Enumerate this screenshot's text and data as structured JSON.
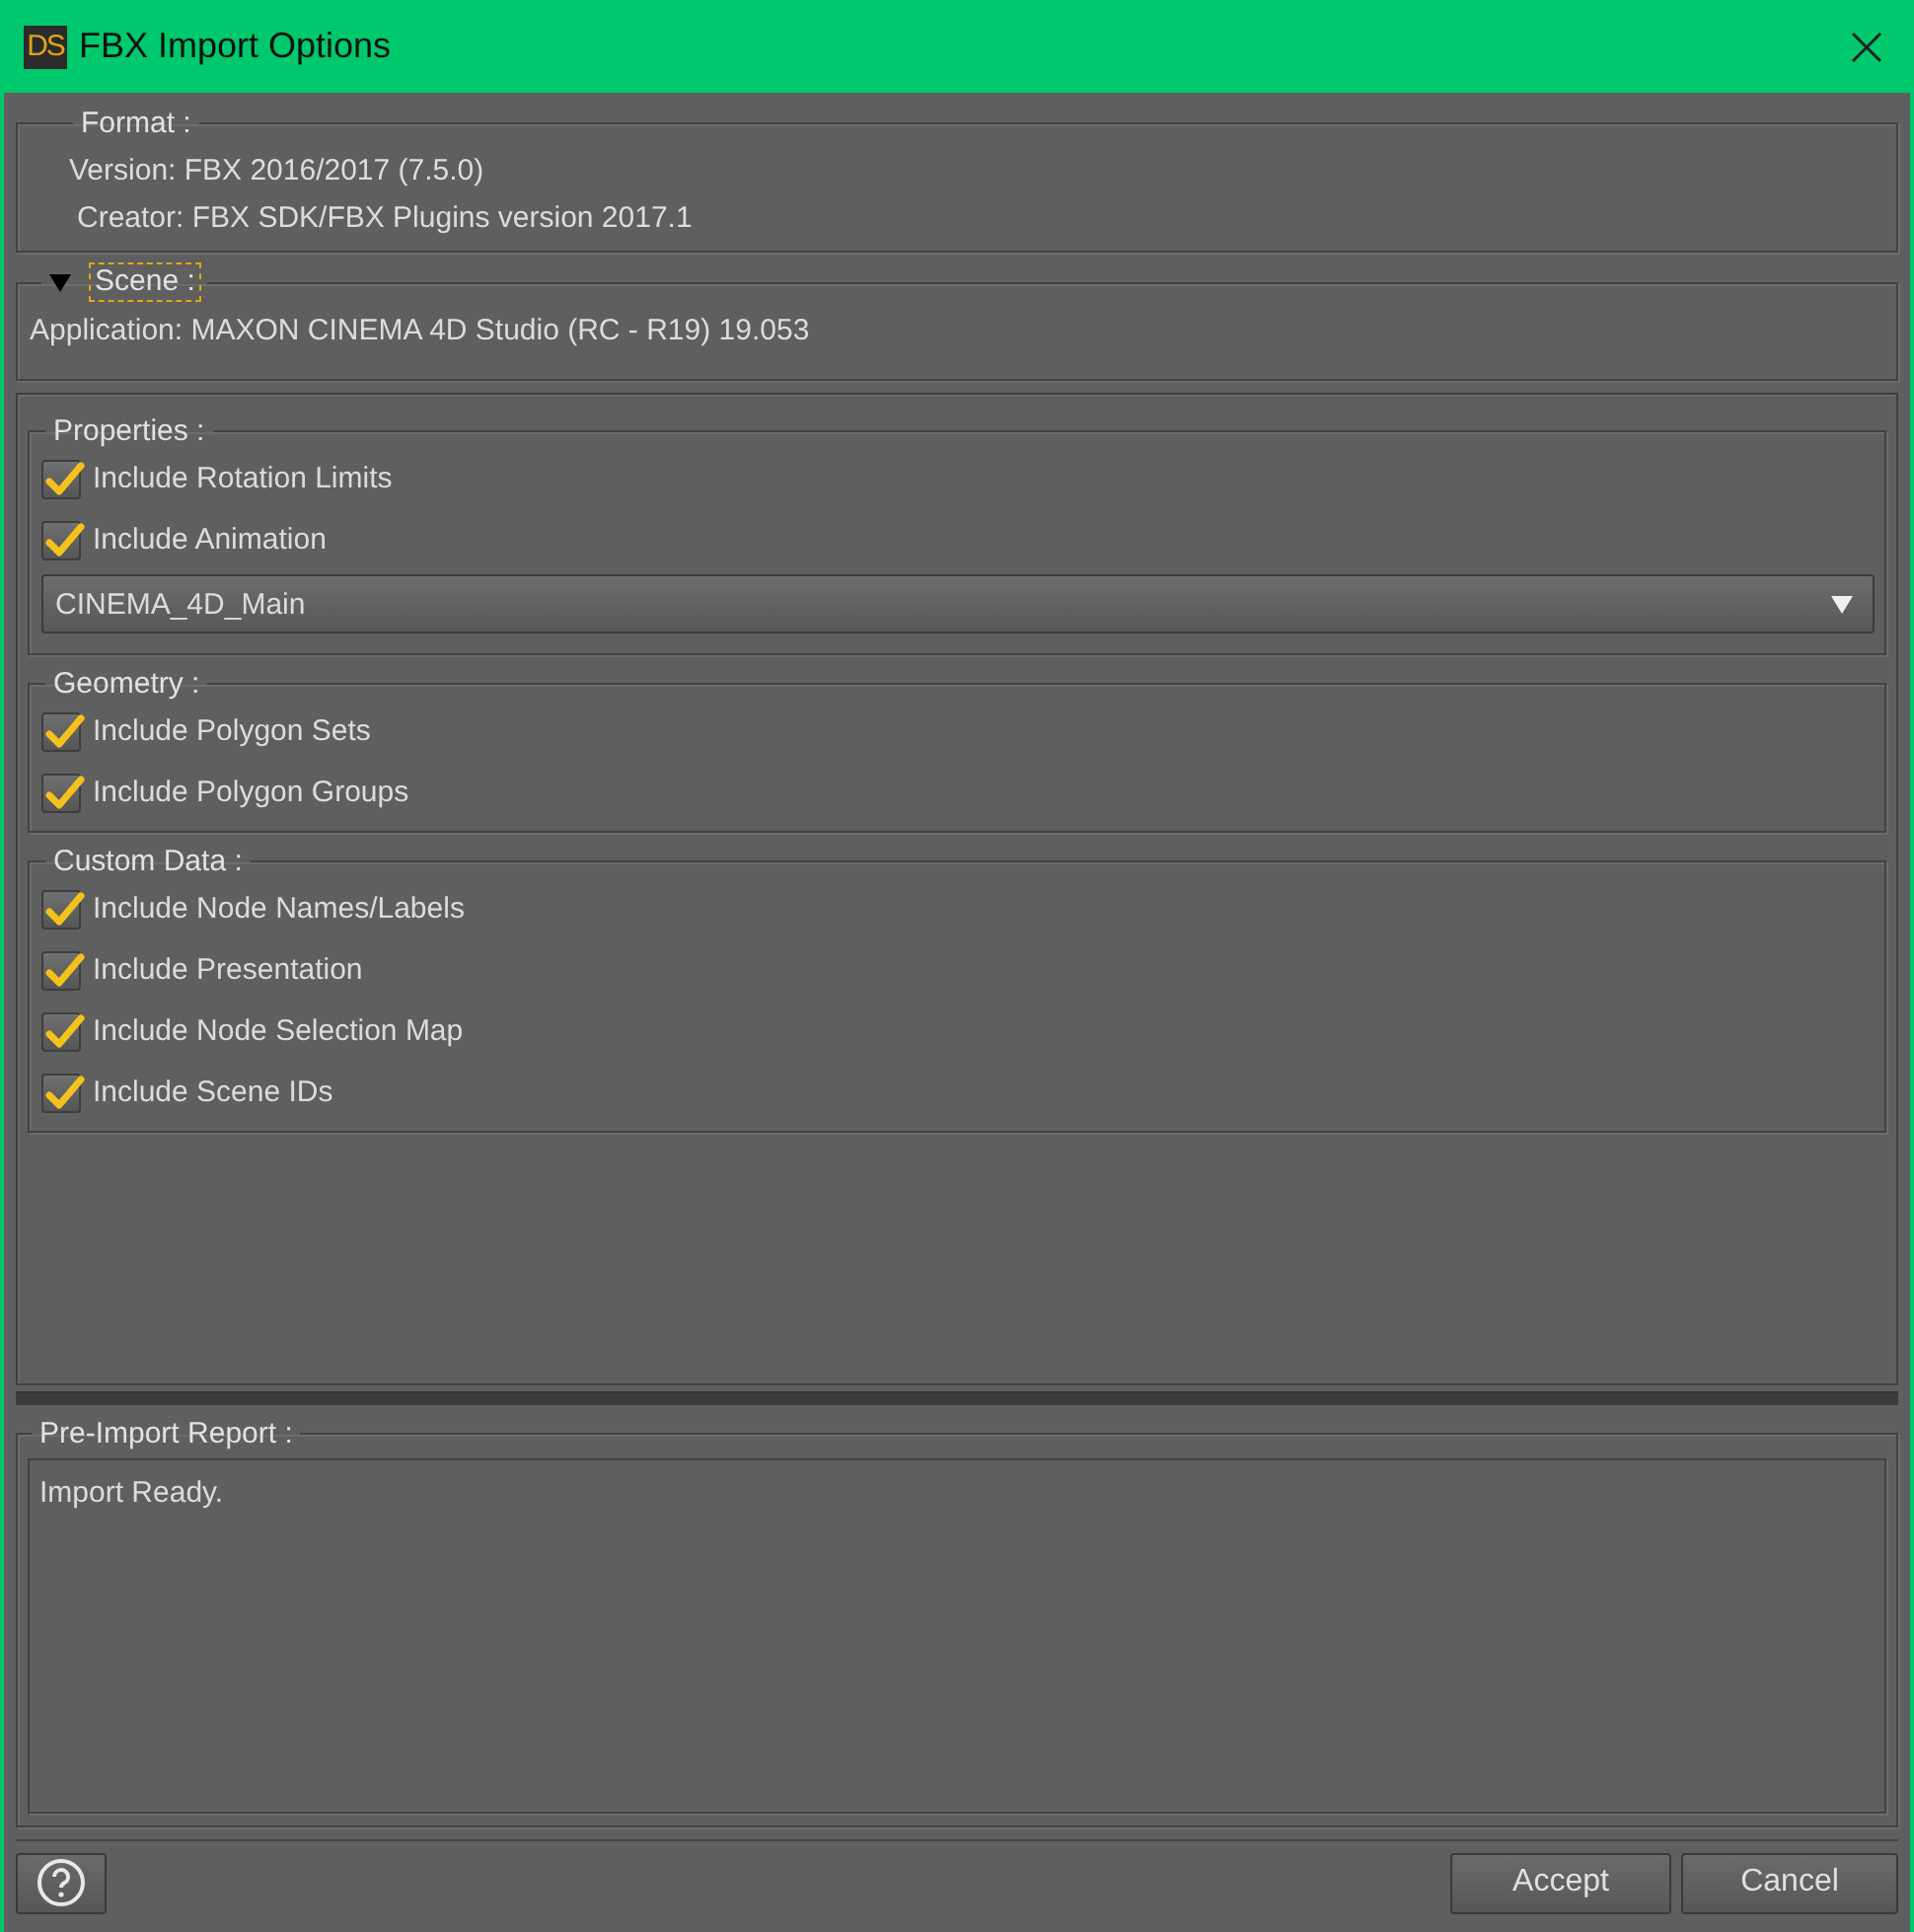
{
  "window": {
    "title": "FBX Import Options",
    "app_badge": "DS"
  },
  "format": {
    "label": "Format :",
    "lines": [
      "Version: FBX 2016/2017 (7.5.0)",
      "Creator: FBX SDK/FBX Plugins version 2017.1"
    ]
  },
  "scene": {
    "label": "Scene :",
    "expanded": true,
    "focused": true,
    "lines": [
      "Application: MAXON CINEMA 4D Studio (RC - R19) 19.053"
    ]
  },
  "sections": [
    {
      "label": "Properties :",
      "items": [
        {
          "kind": "checkbox",
          "label": "Include Rotation Limits",
          "checked": true
        },
        {
          "kind": "checkbox",
          "label": "Include Animation",
          "checked": true
        },
        {
          "kind": "dropdown",
          "value": "CINEMA_4D_Main"
        }
      ]
    },
    {
      "label": "Geometry :",
      "items": [
        {
          "kind": "checkbox",
          "label": "Include Polygon Sets",
          "checked": true
        },
        {
          "kind": "checkbox",
          "label": "Include Polygon Groups",
          "checked": true
        }
      ]
    },
    {
      "label": "Custom Data :",
      "items": [
        {
          "kind": "checkbox",
          "label": "Include Node Names/Labels",
          "checked": true
        },
        {
          "kind": "checkbox",
          "label": "Include Presentation",
          "checked": true
        },
        {
          "kind": "checkbox",
          "label": "Include Node Selection Map",
          "checked": true
        },
        {
          "kind": "checkbox",
          "label": "Include Scene IDs",
          "checked": true
        }
      ]
    }
  ],
  "report": {
    "label": "Pre-Import Report :",
    "text": "Import Ready."
  },
  "buttons": [
    {
      "label": "Accept"
    },
    {
      "label": "Cancel"
    }
  ]
}
